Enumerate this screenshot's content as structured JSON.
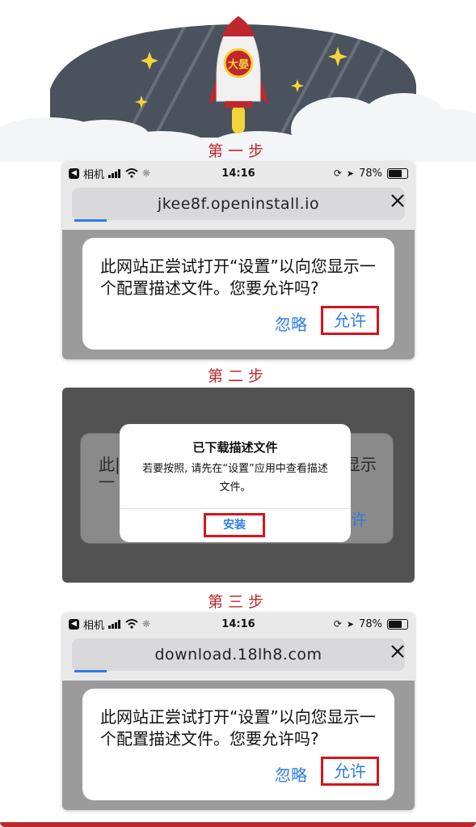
{
  "steps": {
    "one": "第一步",
    "two": "第二步",
    "three": "第三步"
  },
  "logo_text": "大晏",
  "status_bar": {
    "back_app": "相机",
    "time": "14:16",
    "battery": "78%"
  },
  "step1": {
    "url": "jkee8f.openinstall.io",
    "dialog_text": "此网站正尝试打开“设置”以向您显示一个配置描述文件。您要允许吗?",
    "ignore_label": "忽略",
    "allow_label": "允许"
  },
  "step2": {
    "popup_title": "已下载描述文件",
    "popup_body": "若要按照, 请先在“设置”应用中查看描述文件。",
    "install_label": "安装",
    "ghost_left": "此|",
    "ghost_left2": "一",
    "ghost_right": "显示",
    "ghost_allow": "许"
  },
  "step3": {
    "url": "download.18lh8.com",
    "dialog_text": "此网站正尝试打开“设置”以向您显示一个配置描述文件。您要允许吗?",
    "ignore_label": "忽略",
    "allow_label": "允许"
  },
  "colors": {
    "accent_red": "#c0272d",
    "link_blue": "#2f7de1",
    "hero_gray": "#4a525d"
  }
}
